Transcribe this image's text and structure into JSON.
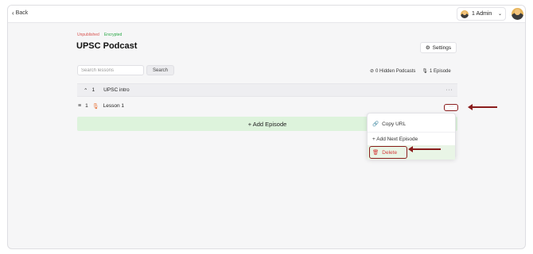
{
  "topbar": {
    "back_label": "Back",
    "back_icon": "chevron-left-icon",
    "user_label": "1 Admin",
    "user_dropdown_icon": "chevron-down-icon"
  },
  "course": {
    "status_badge": "Unpublished",
    "encryption_badge": "Encrypted",
    "title": "UPSC Podcast",
    "settings_label": "Settings"
  },
  "search": {
    "placeholder": "Search lessons",
    "button_label": "Search"
  },
  "stats": {
    "hidden_podcasts": "0 Hidden Podcasts",
    "episodes": "1 Episode"
  },
  "section": {
    "number": "1",
    "title": "UPSC intro",
    "more_label": "···"
  },
  "lesson": {
    "number": "1",
    "title": "Lesson 1",
    "more_label": "···"
  },
  "add_episode_label": "+ Add Episode",
  "menu": {
    "items": [
      {
        "label": "Copy URL",
        "icon": "link-icon"
      },
      {
        "label": "+ Add Next Episode",
        "icon": "plus-icon"
      },
      {
        "label": "Delete",
        "icon": "trash-icon"
      }
    ]
  },
  "colors": {
    "annotation": "#8a1c1c",
    "add_episode_bg": "#ddf3dc",
    "delete_text": "#d43c3c",
    "unpublished": "#d9534f",
    "encrypted": "#28a745"
  }
}
